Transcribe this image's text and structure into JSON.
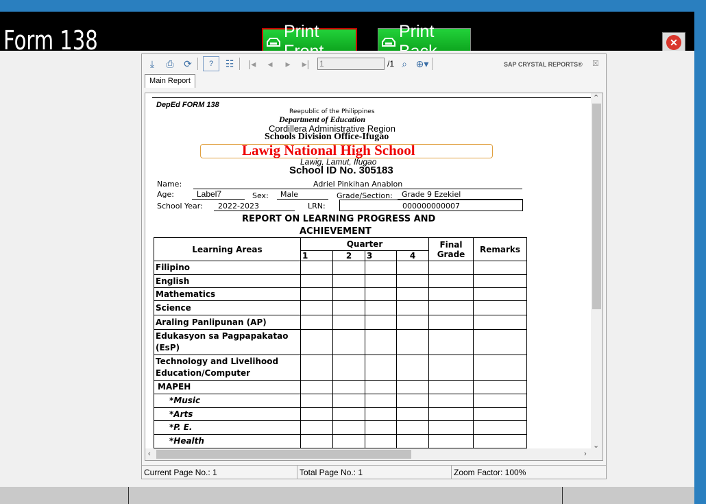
{
  "app": {
    "title": "Form 138",
    "print_front": "Print Front",
    "print_back": "Print Back"
  },
  "viewer": {
    "page_input": "1",
    "page_total": "/1",
    "brand": "SAP CRYSTAL REPORTS®",
    "tab": "Main Report",
    "status": {
      "current_page": "Current Page No.: 1",
      "total_page": "Total Page No.: 1",
      "zoom": "Zoom Factor: 100%"
    }
  },
  "report": {
    "form_label": "DepEd FORM 138",
    "republic": "Reepublic of the Philippines",
    "department": "Department of Education",
    "region": "Cordillera Administrative Region",
    "division": "Schools Division Office-Ifugao",
    "school": "Lawig National High School",
    "address": "Lawig, Lamut, Ifugao",
    "school_id": "School ID No. 305183",
    "name_label": "Name:",
    "name_value": "Adriel Pinkihan Anablon",
    "age_label": "Age:",
    "age_value": "Label7",
    "sex_label": "Sex:",
    "sex_value": "Male",
    "grade_label": "Grade/Section:",
    "grade_value": "Grade 9  Ezekiel",
    "sy_label": "School Year:",
    "sy_value": "2022-2023",
    "lrn_label": "LRN:",
    "lrn_value": "000000000007",
    "report_title_1": "REPORT ON LEARNING PROGRESS AND",
    "report_title_2": "ACHIEVEMENT",
    "table": {
      "learning_areas": "Learning Areas",
      "quarter": "Quarter",
      "q1": "1",
      "q2": "2",
      "q3": "3",
      "q4": "4",
      "final_1": "Final",
      "final_2": "Grade",
      "remarks": "Remarks",
      "subjects": [
        "Filipino",
        "English",
        "Mathematics",
        "Science",
        "Araling Panlipunan (AP)",
        "Edukasyon sa Pagpapakatao (EsP)",
        "Technology and Livelihood Education/Computer",
        "MAPEH",
        "*Music",
        "*Arts",
        "*P. E.",
        "*Health"
      ]
    }
  }
}
